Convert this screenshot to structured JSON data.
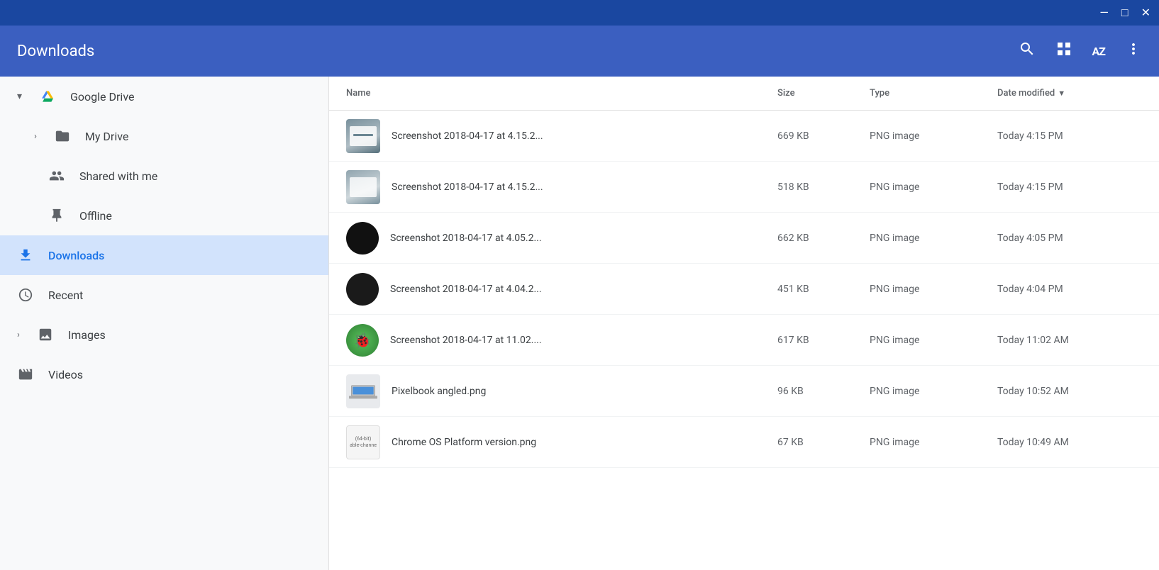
{
  "titlebar": {
    "minimize_label": "—",
    "maximize_label": "□",
    "close_label": "✕"
  },
  "header": {
    "title": "Downloads",
    "search_tooltip": "Search",
    "grid_tooltip": "Grid view",
    "sort_tooltip": "Sort options",
    "more_tooltip": "More options"
  },
  "sidebar": {
    "items": [
      {
        "id": "google-drive",
        "label": "Google Drive",
        "indent": 0,
        "expanded": true,
        "icon": "drive"
      },
      {
        "id": "my-drive",
        "label": "My Drive",
        "indent": 1,
        "expanded": false,
        "icon": "folder"
      },
      {
        "id": "shared-with-me",
        "label": "Shared with me",
        "indent": 1,
        "expanded": false,
        "icon": "people"
      },
      {
        "id": "offline",
        "label": "Offline",
        "indent": 1,
        "expanded": false,
        "icon": "pin"
      },
      {
        "id": "downloads",
        "label": "Downloads",
        "indent": 0,
        "active": true,
        "icon": "download"
      },
      {
        "id": "recent",
        "label": "Recent",
        "indent": 0,
        "icon": "clock"
      },
      {
        "id": "images",
        "label": "Images",
        "indent": 0,
        "expanded": false,
        "icon": "image"
      },
      {
        "id": "videos",
        "label": "Videos",
        "indent": 0,
        "icon": "video"
      }
    ]
  },
  "table": {
    "columns": [
      {
        "id": "name",
        "label": "Name"
      },
      {
        "id": "size",
        "label": "Size"
      },
      {
        "id": "type",
        "label": "Type"
      },
      {
        "id": "date",
        "label": "Date modified",
        "sorted": true,
        "direction": "desc"
      }
    ],
    "rows": [
      {
        "id": "file1",
        "name": "Screenshot 2018-04-17 at 4.15.2...",
        "size": "669 KB",
        "type": "PNG image",
        "date": "Today 4:15 PM",
        "thumb_type": "screenshot_light"
      },
      {
        "id": "file2",
        "name": "Screenshot 2018-04-17 at 4.15.2...",
        "size": "518 KB",
        "type": "PNG image",
        "date": "Today 4:15 PM",
        "thumb_type": "screenshot_light2"
      },
      {
        "id": "file3",
        "name": "Screenshot 2018-04-17 at 4.05.2...",
        "size": "662 KB",
        "type": "PNG image",
        "date": "Today 4:05 PM",
        "thumb_type": "black_circle"
      },
      {
        "id": "file4",
        "name": "Screenshot 2018-04-17 at 4.04.2...",
        "size": "451 KB",
        "type": "PNG image",
        "date": "Today 4:04 PM",
        "thumb_type": "black_circle2"
      },
      {
        "id": "file5",
        "name": "Screenshot 2018-04-17 at 11.02....",
        "size": "617 KB",
        "type": "PNG image",
        "date": "Today 11:02 AM",
        "thumb_type": "green_icon"
      },
      {
        "id": "file6",
        "name": "Pixelbook angled.png",
        "size": "96 KB",
        "type": "PNG image",
        "date": "Today 10:52 AM",
        "thumb_type": "pixelbook"
      },
      {
        "id": "file7",
        "name": "Chrome OS Platform version.png",
        "size": "67 KB",
        "type": "PNG image",
        "date": "Today 10:49 AM",
        "thumb_type": "chrome_os"
      }
    ]
  }
}
